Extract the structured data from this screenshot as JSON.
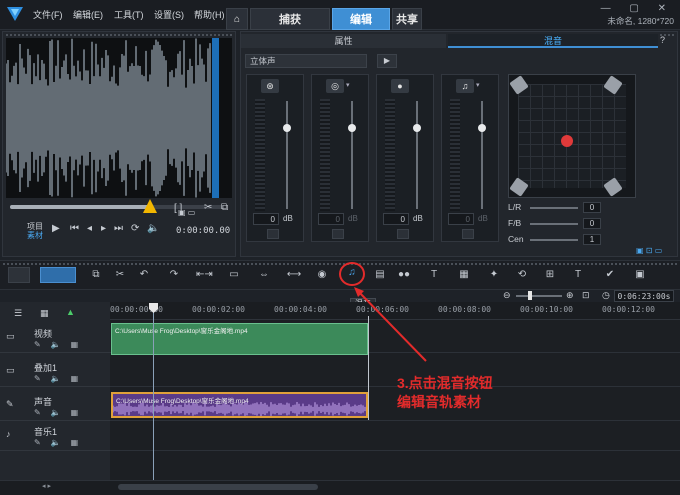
{
  "menu": [
    "文件(F)",
    "编辑(E)",
    "工具(T)",
    "设置(S)",
    "帮助(H)"
  ],
  "tabs": {
    "home_icon": "home-icon",
    "capture": "捕获",
    "edit": "编辑",
    "share": "共享"
  },
  "window": {
    "controls": "— ▢ ✕",
    "project_info": "未命名, 1280*720"
  },
  "preview": {
    "mode_project": "项目",
    "mode_clip": "素材",
    "timecode": "0:00:00.00",
    "brackets": "[ ]"
  },
  "options_panel": {
    "properties_tab": "属性",
    "mixer_tab": "混音",
    "channel_mode": "立体声",
    "channels": [
      {
        "icon": "film-reel-icon",
        "glyph": "⊛",
        "value": "0",
        "unit": "dB",
        "level": 0.25,
        "enabled": true
      },
      {
        "icon": "overlay-icon",
        "glyph": "◎",
        "value": "0",
        "unit": "dB",
        "level": 0.25,
        "enabled": false
      },
      {
        "icon": "voice-icon",
        "glyph": "●",
        "value": "0",
        "unit": "dB",
        "level": 0.25,
        "enabled": true
      },
      {
        "icon": "music-note-icon",
        "glyph": "♫",
        "value": "0",
        "unit": "dB",
        "level": 0.25,
        "enabled": false
      }
    ],
    "surround_rows": [
      {
        "label": "L/R",
        "value": "0"
      },
      {
        "label": "F/B",
        "value": "0"
      },
      {
        "label": "Cen",
        "value": "1"
      }
    ]
  },
  "toolbar": {
    "mixer_tooltip": "混音"
  },
  "timeline": {
    "timecode": "0:06:23:00s",
    "ruler": [
      "00:00:00:00",
      "00:00:02:00",
      "00:00:04:00",
      "00:00:06:00",
      "00:00:08:00",
      "00:00:10:00",
      "00:00:12:00"
    ],
    "tracks": [
      {
        "name": "视频",
        "icon": "video-track-icon",
        "glyph": "▭"
      },
      {
        "name": "叠加1",
        "icon": "overlay-track-icon",
        "glyph": "▭"
      },
      {
        "name": "声音",
        "icon": "voice-track-icon",
        "glyph": "✎"
      },
      {
        "name": "音乐1",
        "icon": "music-track-icon",
        "glyph": "♪"
      }
    ],
    "video_clip": "C:\\Users\\Muse Frog\\Desktop\\窗乐金阁地.mp4",
    "audio_clip": "C:\\Users\\Muse Frog\\Desktop\\窗乐金阁地.mp4"
  },
  "annotation": {
    "line1": "3.点击混音按钮",
    "line2": "编辑音轨素材"
  }
}
